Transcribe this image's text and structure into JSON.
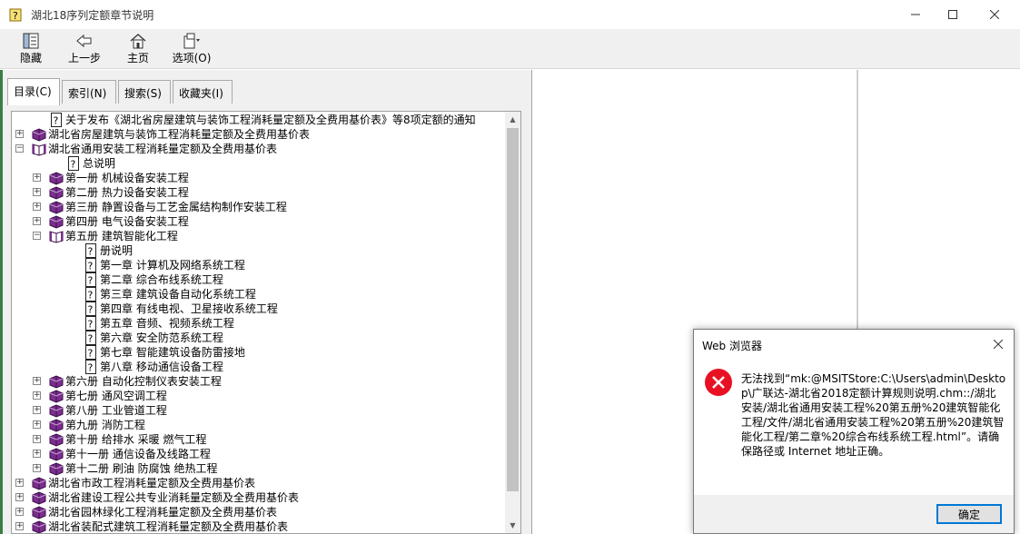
{
  "window": {
    "title": "湖北18序列定额章节说明"
  },
  "toolbar": {
    "hide": "隐藏",
    "back": "上一步",
    "home": "主页",
    "options": "选项(O)"
  },
  "tabs": [
    {
      "label": "目录(C)"
    },
    {
      "label": "索引(N)"
    },
    {
      "label": "搜索(S)"
    },
    {
      "label": "收藏夹(I)"
    }
  ],
  "tree": [
    {
      "label": "关于发布《湖北省房屋建筑与装饰工程消耗量定额及全费用基价表》等8项定额的通知"
    },
    {
      "label": "湖北省房屋建筑与装饰工程消耗量定额及全费用基价表"
    },
    {
      "label": "湖北省通用安装工程消耗量定额及全费用基价表"
    },
    {
      "label": "总说明"
    },
    {
      "label": "第一册  机械设备安装工程"
    },
    {
      "label": "第二册  热力设备安装工程"
    },
    {
      "label": "第三册  静置设备与工艺金属结构制作安装工程"
    },
    {
      "label": "第四册  电气设备安装工程"
    },
    {
      "label": "第五册  建筑智能化工程"
    },
    {
      "label": "册说明"
    },
    {
      "label": "第一章  计算机及网络系统工程"
    },
    {
      "label": "第二章  综合布线系统工程"
    },
    {
      "label": "第三章  建筑设备自动化系统工程"
    },
    {
      "label": "第四章  有线电视、卫星接收系统工程"
    },
    {
      "label": "第五章  音频、视频系统工程"
    },
    {
      "label": "第六章  安全防范系统工程"
    },
    {
      "label": "第七章  智能建筑设备防雷接地"
    },
    {
      "label": "第八章  移动通信设备工程"
    },
    {
      "label": "第六册  自动化控制仪表安装工程"
    },
    {
      "label": "第七册  通风空调工程"
    },
    {
      "label": "第八册  工业管道工程"
    },
    {
      "label": "第九册  消防工程"
    },
    {
      "label": "第十册  给排水  采暖  燃气工程"
    },
    {
      "label": "第十一册  通信设备及线路工程"
    },
    {
      "label": "第十二册  刷油  防腐蚀  绝热工程"
    },
    {
      "label": "湖北省市政工程消耗量定额及全费用基价表"
    },
    {
      "label": "湖北省建设工程公共专业消耗量定额及全费用基价表"
    },
    {
      "label": "湖北省园林绿化工程消耗量定额及全费用基价表"
    },
    {
      "label": "湖北省装配式建筑工程消耗量定额及全费用基价表"
    }
  ],
  "dialog": {
    "title": "Web 浏览器",
    "message": "无法找到“mk:@MSITStore:C:\\Users\\admin\\Desktop\\广联达-湖北省2018定额计算规则说明.chm::/湖北安装/湖北省通用安装工程%20第五册%20建筑智能化工程/文件/湖北省通用安装工程%20第五册%20建筑智能化工程/第二章%20综合布线系统工程.html”。请确保路径或 Internet 地址正确。",
    "ok": "确定"
  },
  "colors": {
    "book": "#7a2e8e",
    "error": "#e81123",
    "accent": "#0078d7"
  }
}
